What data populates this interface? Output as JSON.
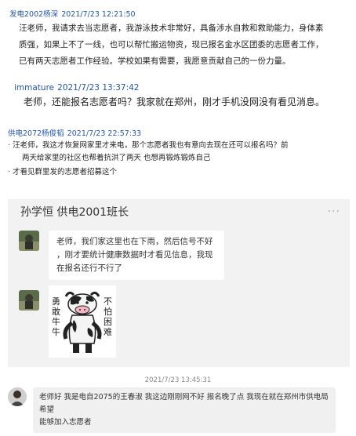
{
  "post1": {
    "name": "发电2002杨深",
    "time": "2021/7/23 12:21:50",
    "lines": [
      "汪老师，我请求去当志愿者，我游泳技术非常好，具备涉水自救和救助能力，身体素",
      "质强，如果上不了一线，也可以帮忙搬运物资，现已报名金水区团委的志愿者工作，",
      "已有两天志愿者工作经验。学校如果有需要，我愿意贡献自己的一份力量。"
    ]
  },
  "post2": {
    "name": "immature",
    "time": "2021/7/23 13:37:42",
    "text": "老师，还能报名志愿者吗？我家就在郑州，刚才手机没网没有看见消息。"
  },
  "post3": {
    "name": "供电2072杨俊韬",
    "time": "2021/7/23 22:57:33",
    "bullet1_a": "汪老师，我这才恢复网家里才来电，那个志愿者我也有意向去现在还可以报名吗？前",
    "bullet1_b": "两天给家里的社区也帮着抗洪了两天 也想再锻炼锻炼自己",
    "bullet2": "才看见群里发的志愿者招募这个",
    "bullet_char": "·"
  },
  "chat": {
    "title": "孙学恒 供电2001班长",
    "more": "···",
    "bubble1_lines": [
      "老师，我们家这里也在下雨，然后信号不好",
      "，刚才要统计健康数据时才看见信息，我现",
      "在报名还行不行了"
    ],
    "sticker_left": "勇敢牛牛",
    "sticker_right": "不怕困难"
  },
  "bottom": {
    "timestamp": "2021/7/23 13:45:31",
    "bubble_lines": [
      "老师好 我是电自2075的王春淑 我这边刚刚网不好 报名晚了点 我现在就在郑州市供电局希望",
      "能够加入志愿者"
    ]
  },
  "colors": {
    "name_blue": "#2255aa",
    "chat_bg": "#f2f2f2"
  }
}
